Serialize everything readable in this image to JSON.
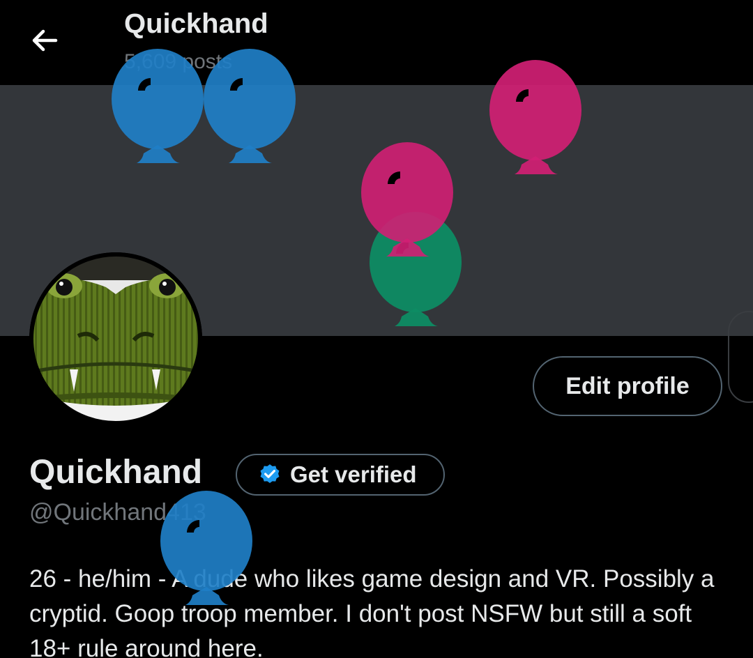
{
  "header": {
    "title": "Quickhand",
    "posts_count": "5,609 posts"
  },
  "profile": {
    "display_name": "Quickhand",
    "handle": "@Quickhand413",
    "get_verified_label": "Get verified",
    "edit_profile_label": "Edit profile",
    "bio": "26 - he/him - A dude who likes game design and VR. Possibly a cryptid. Goop troop member. I don't post NSFW but still a soft 18+ rule around here."
  },
  "icons": {
    "back": "back-arrow-icon",
    "verified": "verified-badge-icon",
    "balloon": "balloon-icon"
  },
  "colors": {
    "background": "#000000",
    "banner": "#33363a",
    "text_primary": "#e7e9ea",
    "text_secondary": "#71767b",
    "border": "#536471",
    "verified_blue": "#1d9bf0",
    "balloon_blue": "#1f7fc7",
    "balloon_pink": "#d11f74",
    "balloon_green": "#0e8c63"
  }
}
